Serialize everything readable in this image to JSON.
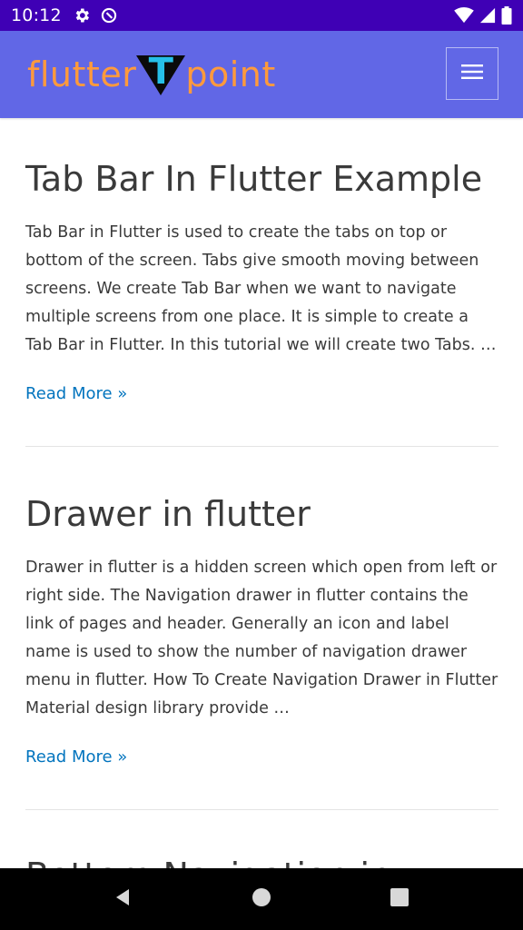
{
  "status_bar": {
    "time": "10:12",
    "icons": [
      "settings-icon",
      "data-saver-icon",
      "wifi-icon",
      "signal-icon",
      "battery-icon"
    ]
  },
  "header": {
    "logo_left": "flutter",
    "logo_letter": "T",
    "logo_right": "point",
    "menu_icon": "hamburger-menu-icon",
    "colors": {
      "background": "#6167e6",
      "logo_text": "#ff9a3c",
      "logo_letter": "#26c0e8"
    }
  },
  "posts": [
    {
      "title": "Tab Bar In Flutter Example",
      "excerpt": "Tab Bar in Flutter is used to create the tabs on top or bottom of the screen. Tabs give smooth moving between screens. We create Tab Bar when we want to navigate multiple screens from one place. It is simple to create a Tab Bar in Flutter. In this tutorial we will create two Tabs. …",
      "read_more": "Read More »"
    },
    {
      "title": "Drawer in flutter",
      "excerpt": "Drawer in flutter is a hidden screen which open from left or right side. The Navigation drawer in flutter contains the link of pages and header. Generally an icon and label name is used to show the number of navigation drawer menu in flutter. How To Create Navigation Drawer in Flutter Material design library provide …",
      "read_more": "Read More »"
    },
    {
      "title": "Bottom Navigation in flutter"
    }
  ],
  "nav_bar": {
    "buttons": [
      "back-icon",
      "home-icon",
      "recents-icon"
    ]
  },
  "colors": {
    "status_bar": "#3f00b5",
    "link": "#0274be",
    "text": "#3a3a3a"
  }
}
